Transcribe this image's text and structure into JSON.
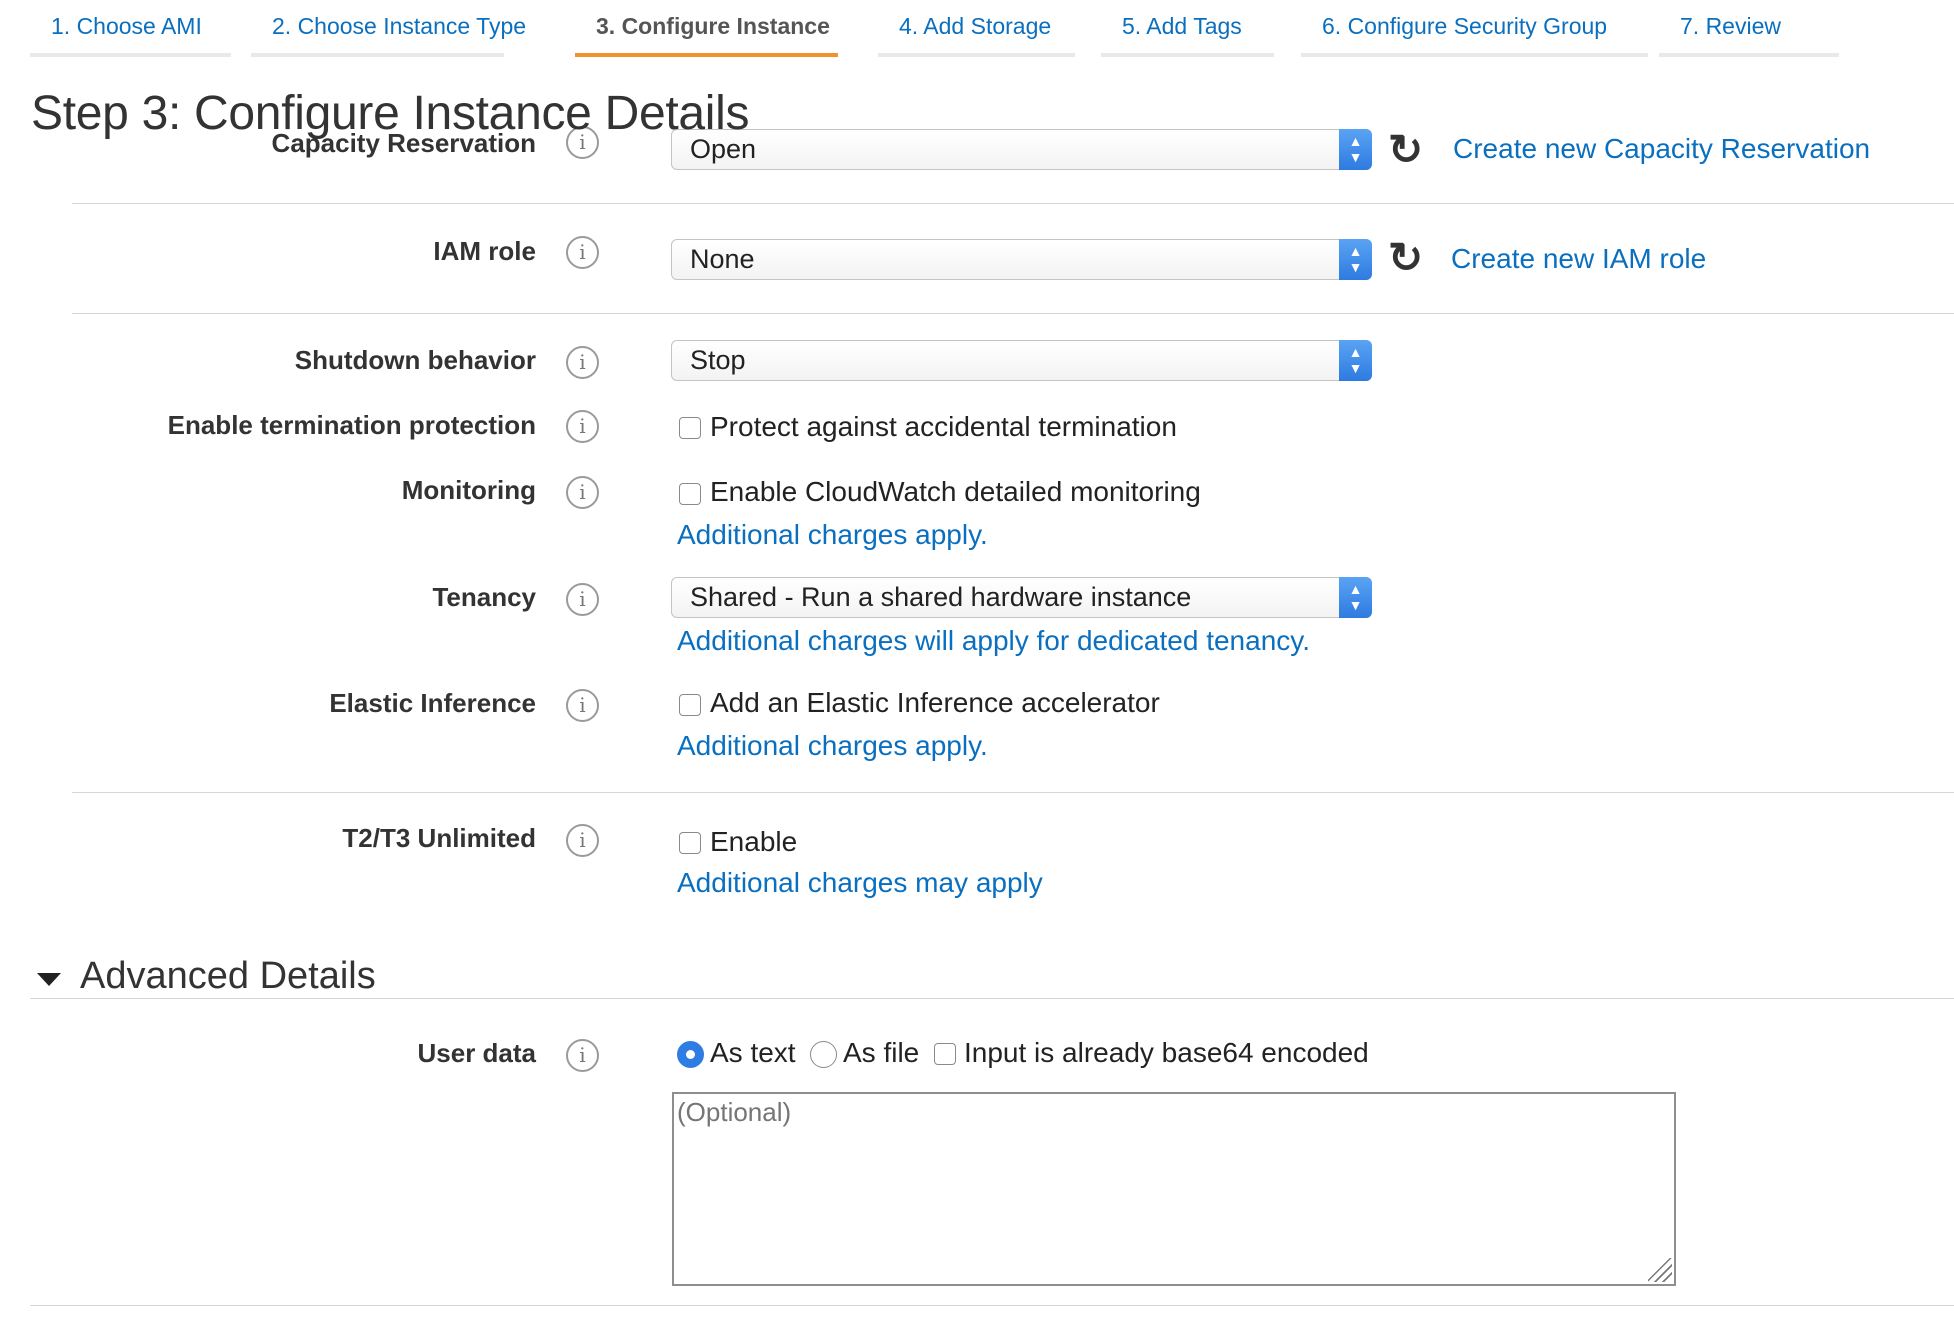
{
  "wizard": {
    "tabs": [
      {
        "label": "1. Choose AMI"
      },
      {
        "label": "2. Choose Instance Type"
      },
      {
        "label": "3. Configure Instance",
        "active": true
      },
      {
        "label": "4. Add Storage"
      },
      {
        "label": "5. Add Tags"
      },
      {
        "label": "6. Configure Security Group"
      },
      {
        "label": "7. Review"
      }
    ]
  },
  "page": {
    "title": "Step 3: Configure Instance Details"
  },
  "form": {
    "capacity_reservation": {
      "label": "Capacity Reservation",
      "value": "Open",
      "create_link": "Create new Capacity Reservation"
    },
    "iam_role": {
      "label": "IAM role",
      "value": "None",
      "create_link": "Create new IAM role"
    },
    "shutdown_behavior": {
      "label": "Shutdown behavior",
      "value": "Stop"
    },
    "termination_protection": {
      "label": "Enable termination protection",
      "checkbox_label": "Protect against accidental termination",
      "checked": false
    },
    "monitoring": {
      "label": "Monitoring",
      "checkbox_label": "Enable CloudWatch detailed monitoring",
      "checked": false,
      "note_link": "Additional charges apply."
    },
    "tenancy": {
      "label": "Tenancy",
      "value": "Shared - Run a shared hardware instance",
      "note_link": "Additional charges will apply for dedicated tenancy."
    },
    "elastic_inference": {
      "label": "Elastic Inference",
      "checkbox_label": "Add an Elastic Inference accelerator",
      "checked": false,
      "note_link": "Additional charges apply."
    },
    "t2t3_unlimited": {
      "label": "T2/T3 Unlimited",
      "checkbox_label": "Enable",
      "checked": false,
      "note_link": "Additional charges may apply"
    }
  },
  "advanced": {
    "title": "Advanced Details",
    "user_data": {
      "label": "User data",
      "options": {
        "as_text": "As text",
        "as_file": "As file",
        "base64": "Input is already base64 encoded"
      },
      "selected": "As text",
      "placeholder": "(Optional)"
    }
  },
  "icons": {
    "info": "i",
    "refresh": "↻"
  },
  "colors": {
    "link": "#0a6fbf",
    "active_tab_underline": "#f0922d",
    "select_arrow": "#2e7be0"
  }
}
